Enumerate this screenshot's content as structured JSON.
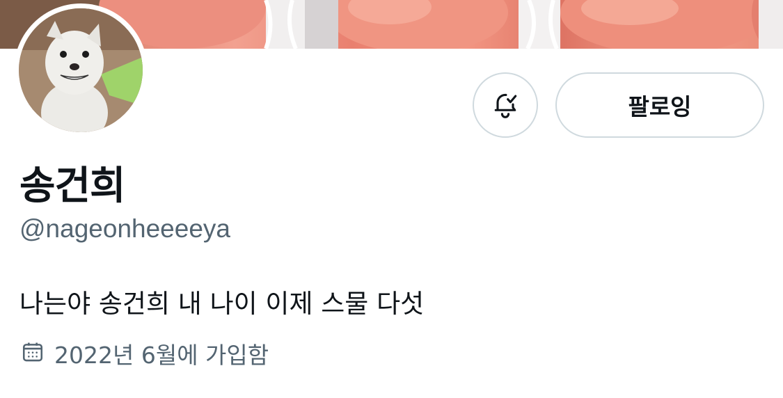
{
  "profile": {
    "display_name": "송건희",
    "handle": "@nageonheeeeya",
    "bio": "나는야 송건희 내 나이 이제 스물 다섯",
    "joined": "2022년 6월에 가입함"
  },
  "actions": {
    "follow_label": "팔로잉",
    "notify_icon": "bell-check-icon"
  },
  "icons": {
    "calendar": "calendar-icon"
  },
  "colors": {
    "text_primary": "#0f1419",
    "text_secondary": "#536471",
    "border": "#cfd9de"
  }
}
